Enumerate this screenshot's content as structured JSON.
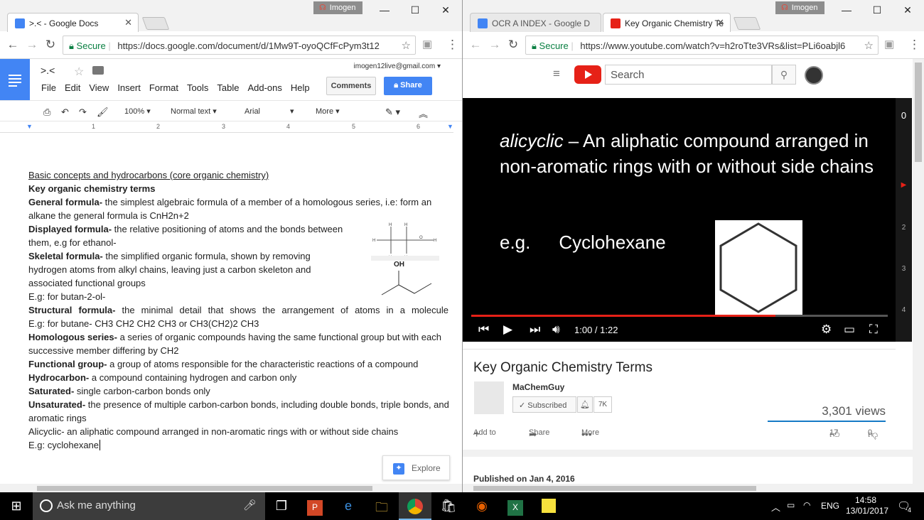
{
  "left_window": {
    "profile": "Imogen",
    "tabs": [
      {
        "label": ">.< - Google Docs",
        "active": true
      }
    ],
    "secure_label": "Secure",
    "url": "https://docs.google.com/document/d/1Mw9T-oyoQCfFcPym3t12",
    "doc": {
      "title": ">.<",
      "email": "imogen12live@gmail.com",
      "menu": [
        "File",
        "Edit",
        "View",
        "Insert",
        "Format",
        "Tools",
        "Table",
        "Add-ons",
        "Help"
      ],
      "comments_label": "Comments",
      "share_label": "Share",
      "toolbar": {
        "zoom": "100%",
        "style": "Normal text",
        "font": "Arial",
        "more": "More"
      },
      "ruler_numbers": [
        "1",
        "2",
        "3",
        "4",
        "5",
        "6"
      ],
      "heading": "Basic concepts and hydrocarbons (core organic chemistry)",
      "subheading": "Key organic chemistry terms",
      "terms": [
        {
          "term": "General formula-",
          "text": " the simplest algebraic formula of a member of a homologous series, i.e: form an alkane the general formula is CnH2n+2"
        },
        {
          "term": "Displayed formula-",
          "text": " the relative positioning of atoms and the bonds between them, e.g for ethanol-"
        },
        {
          "term": "Skeletal formula-",
          "text": " the simplified organic formula, shown by removing hydrogen atoms from alkyl chains, leaving just a carbon skeleton and associated functional groups"
        },
        {
          "term": "",
          "text": "E.g: for butan-2-ol-"
        },
        {
          "term": "Structural formula-",
          "text": " the minimal detail that shows the arrangement of atoms in a molecule"
        },
        {
          "term": "",
          "text": "E.g: for butane- CH3 CH2 CH2 CH3 or CH3(CH2)2 CH3"
        },
        {
          "term": "Homologous series-",
          "text": " a series of organic compounds having the same functional group but with each successive member differing  by CH2"
        },
        {
          "term": "Functional group-",
          "text": " a group of atoms responsible for the characteristic reactions of a compound"
        },
        {
          "term": "Hydrocarbon-",
          "text": " a compound containing hydrogen and carbon only"
        },
        {
          "term": "Saturated-",
          "text": " single carbon-carbon bonds only"
        },
        {
          "term": "Unsaturated-",
          "text": " the presence of multiple carbon-carbon bonds, including double bonds, triple bonds, and aromatic rings"
        },
        {
          "term": "",
          "text": "Alicyclic- an aliphatic compound arranged in non-aromatic rings with or without side chains"
        },
        {
          "term": "",
          "text": "E.g: cyclohexane"
        }
      ],
      "oh_label": "OH",
      "explore_label": "Explore"
    }
  },
  "right_window": {
    "profile": "Imogen",
    "tabs": [
      {
        "label": "OCR A INDEX - Google D",
        "active": false
      },
      {
        "label": "Key Organic Chemistry Te",
        "active": true
      }
    ],
    "secure_label": "Secure",
    "url": "https://www.youtube.com/watch?v=h2roTte3VRs&list=PLi6oabjl6",
    "youtube": {
      "search_placeholder": "Search",
      "slide_italic": "alicyclic",
      "slide_text": " – An aliphatic compound arranged in non-aromatic rings with or without side chains",
      "slide_eg": "e.g.",
      "slide_example": "Cyclohexane",
      "time": "1:00 / 1:22",
      "progress": 0.73,
      "sidebar_numbers": [
        "2",
        "3",
        "4"
      ],
      "video_title": "Key Organic Chemistry Terms",
      "channel": "MaChemGuy",
      "subscribed_label": "Subscribed",
      "sub_count": "7K",
      "views": "3,301 views",
      "add_to": "Add to",
      "share": "Share",
      "more": "More",
      "likes": "17",
      "dislikes": "0",
      "published": "Published on Jan 4, 2016"
    }
  },
  "taskbar": {
    "search_placeholder": "Ask me anything",
    "language": "ENG",
    "time": "14:58",
    "date": "13/01/2017",
    "notifications": "4"
  }
}
